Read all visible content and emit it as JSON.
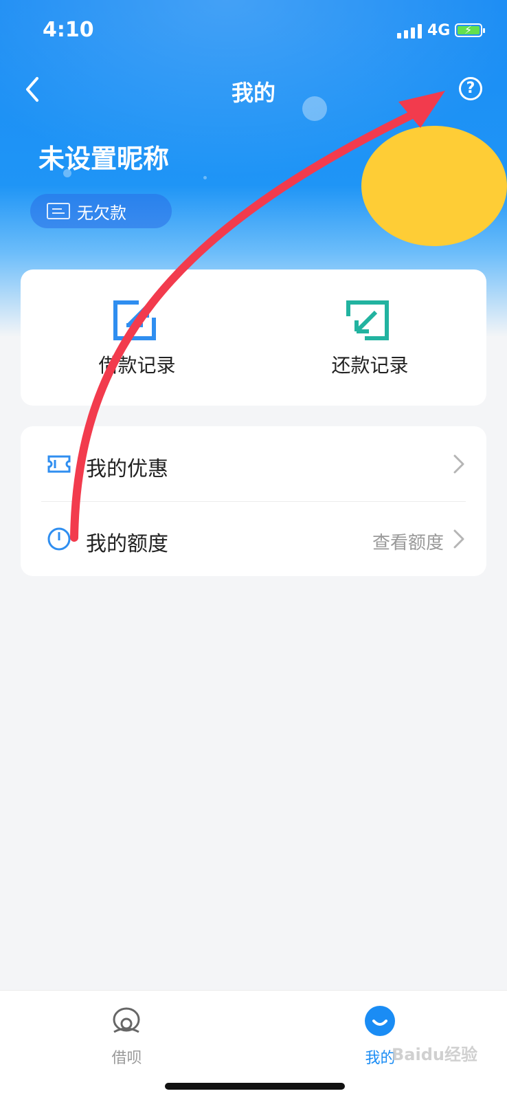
{
  "status_bar": {
    "time": "4:10",
    "network": "4G"
  },
  "nav": {
    "title": "我的",
    "back_icon": "chevron-left-icon",
    "help_icon": "question-circle-icon",
    "help_glyph": "?"
  },
  "profile": {
    "nickname": "未设置昵称",
    "debt_status": "无欠款",
    "avatar_placeholder_color": "#fecd36"
  },
  "records": [
    {
      "label": "借款记录",
      "icon": "borrow-record-icon",
      "color": "#2f8ef0"
    },
    {
      "label": "还款记录",
      "icon": "repay-record-icon",
      "color": "#22b3a0"
    }
  ],
  "menu": [
    {
      "label": "我的优惠",
      "value": "",
      "icon": "coupon-icon"
    },
    {
      "label": "我的额度",
      "value": "查看额度",
      "icon": "credit-gauge-icon"
    }
  ],
  "tabs": [
    {
      "label": "借呗",
      "icon": "jiebei-icon",
      "active": false
    },
    {
      "label": "我的",
      "icon": "smile-icon",
      "active": true
    }
  ],
  "colors": {
    "brand_blue": "#1a8cf4",
    "active_tab": "#1a8cf4",
    "inactive_tab": "#999999",
    "annotation_arrow": "#f23b4d"
  },
  "watermark": "Baidu经验"
}
